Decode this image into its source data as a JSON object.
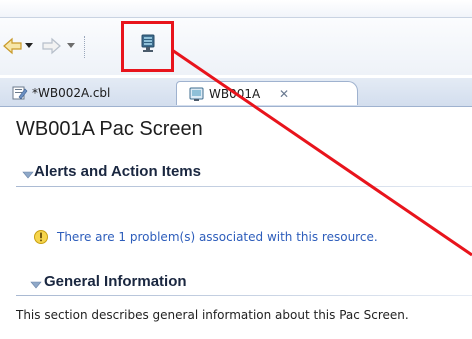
{
  "editor_tabs": [
    {
      "label": "*WB002A.cbl",
      "icon": "cobol-file-icon"
    },
    {
      "label": "WB001A",
      "icon": "pac-screen-icon"
    }
  ],
  "page": {
    "title": "WB001A Pac Screen"
  },
  "sections": {
    "alerts": {
      "title": "Alerts and Action Items",
      "message": "There are 1 problem(s) associated with this resource."
    },
    "general": {
      "title": "General Information",
      "description": "This section describes general information about this Pac Screen."
    }
  },
  "colors": {
    "highlight": "#e8141c",
    "link_text": "#2d5dbb",
    "section_title": "#1a2740"
  }
}
